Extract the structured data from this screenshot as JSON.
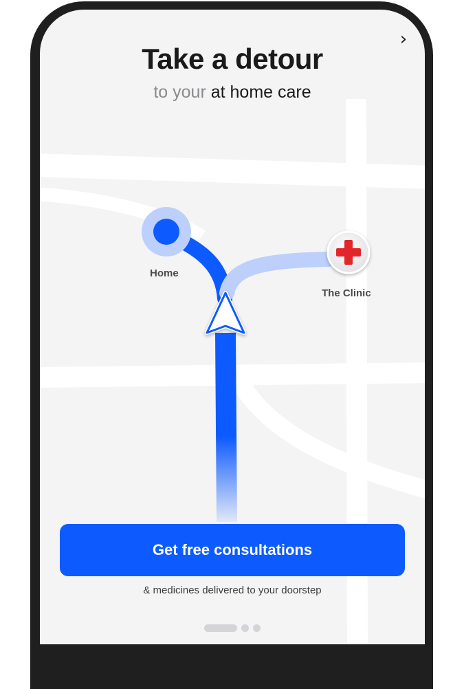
{
  "onboarding": {
    "next_icon": "chevron-right-icon",
    "next_glyph": "›",
    "title": "Take a detour",
    "subtitle_prefix": "to your ",
    "subtitle_emphasis": "at home care"
  },
  "map": {
    "home_label": "Home",
    "clinic_label": "The Clinic",
    "home_icon": "home-location-icon",
    "clinic_icon": "medical-cross-icon",
    "navigation_icon": "navigation-arrow-icon"
  },
  "cta": {
    "label": "Get free consultations",
    "sub_label": "& medicines delivered to your doorstep"
  },
  "pagination": {
    "current": 1,
    "total": 3
  },
  "colors": {
    "primary": "#0d5bff",
    "route_light": "#bcd0fb",
    "clinic_red": "#e3262b",
    "map_road": "#ffffff",
    "map_bg": "#f4f4f5"
  }
}
